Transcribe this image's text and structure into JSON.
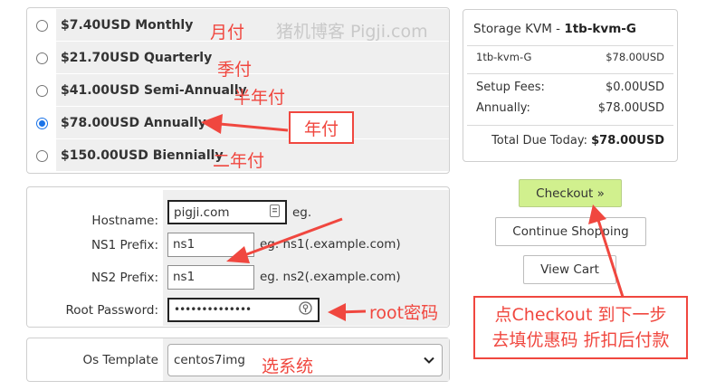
{
  "watermark": "猪机博客 Pigji.com",
  "billing_cycles": [
    {
      "label": "$7.40USD Monthly",
      "checked": false,
      "annotation": "月付"
    },
    {
      "label": "$21.70USD Quarterly",
      "checked": false,
      "annotation": "季付"
    },
    {
      "label": "$41.00USD Semi-Annually",
      "checked": false,
      "annotation": "半年付"
    },
    {
      "label": "$78.00USD Annually",
      "checked": true,
      "annotation": "年付"
    },
    {
      "label": "$150.00USD Biennially",
      "checked": false,
      "annotation": "二年付"
    }
  ],
  "config": {
    "hostname_label": "Hostname:",
    "hostname_value": "pigji.com",
    "hostname_hint": "eg.",
    "ns1_label": "NS1 Prefix:",
    "ns1_value": "ns1",
    "ns1_hint": "eg. ns1(.example.com)",
    "ns2_label": "NS2 Prefix:",
    "ns2_value": "ns1",
    "ns2_hint": "eg. ns2(.example.com)",
    "root_label": "Root Password:",
    "root_value": "••••••••••••••",
    "root_annotation": "root密码"
  },
  "os": {
    "label": "Os Template",
    "selected": "centos7img",
    "annotation": "选系统"
  },
  "summary": {
    "title_prefix": "Storage KVM - ",
    "title_product": "1tb-kvm-G",
    "item_name": "1tb-kvm-G",
    "item_price": "$78.00USD",
    "setup_label": "Setup Fees:",
    "setup_value": "$0.00USD",
    "annual_label": "Annually:",
    "annual_value": "$78.00USD",
    "total_label": "Total Due Today:",
    "total_value": "$78.00USD"
  },
  "buttons": {
    "checkout": "Checkout »",
    "continue": "Continue Shopping",
    "view_cart": "View Cart"
  },
  "note": {
    "line1": "点Checkout 到下一步",
    "line2": "去填优惠码 折扣后付款"
  },
  "colors": {
    "annotation_red": "#f0473f",
    "checkout_green": "#d1f08e",
    "row_gray": "#efefef"
  }
}
